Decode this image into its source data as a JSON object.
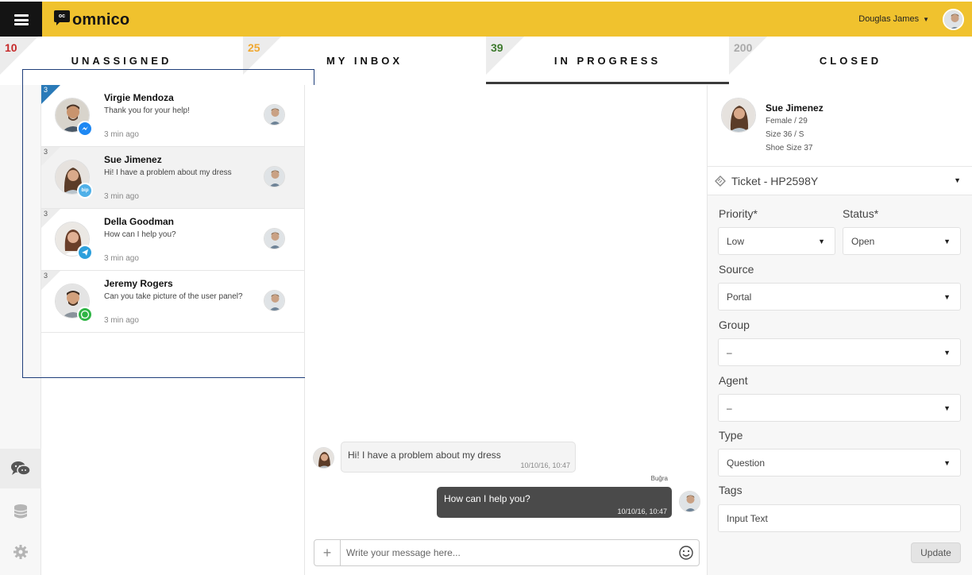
{
  "header": {
    "logo_mark": "oc",
    "logo_text": "omnico",
    "user_name": "Douglas James"
  },
  "tabs": [
    {
      "count": "10",
      "count_color": "#c62828",
      "label": "UNASSIGNED",
      "active": false
    },
    {
      "count": "25",
      "count_color": "#f0a830",
      "label": "MY INBOX",
      "active": false
    },
    {
      "count": "39",
      "count_color": "#3e7a2e",
      "label": "IN PROGRESS",
      "active": true
    },
    {
      "count": "200",
      "count_color": "#aaaaaa",
      "label": "CLOSED",
      "active": false
    }
  ],
  "rail": [
    "chat-icon",
    "database-icon",
    "settings-icon"
  ],
  "conversations": [
    {
      "badge": "3",
      "name": "Virgie Mendoza",
      "message": "Thank you for your help!",
      "time": "3 min ago",
      "channel": "messenger-icon",
      "channel_color": "#1e88f3"
    },
    {
      "badge": "3",
      "name": "Sue Jimenez",
      "message": "Hi! I have a problem about my dress",
      "time": "3 min ago",
      "channel": "bip-icon",
      "channel_color": "#4fb0e8",
      "channel_text": "bip"
    },
    {
      "badge": "3",
      "name": "Della Goodman",
      "message": "How can I help you?",
      "time": "3 min ago",
      "channel": "telegram-icon",
      "channel_color": "#2ea0dc"
    },
    {
      "badge": "3",
      "name": "Jeremy Rogers",
      "message": "Can you take picture of the user panel?",
      "time": "3 min ago",
      "channel": "whatsapp-icon",
      "channel_color": "#2fb545"
    }
  ],
  "chat": {
    "incoming": {
      "text": "Hi! I have a problem about my dress",
      "time": "10/10/16, 10:47"
    },
    "outgoing_sender": "Buğra",
    "outgoing": {
      "text": "How can I help you?",
      "time": "10/10/16, 10:47"
    },
    "composer_placeholder": "Write your message here..."
  },
  "profile": {
    "name": "Sue Jimenez",
    "gender_age": "Female / 29",
    "size": "Size 36 / S",
    "shoe_size": "Shoe Size 37"
  },
  "ticket": {
    "label": "Ticket - HP2598Y",
    "priority_label": "Priority*",
    "priority_value": "Low",
    "status_label": "Status*",
    "status_value": "Open",
    "source_label": "Source",
    "source_value": "Portal",
    "group_label": "Group",
    "group_value": "–",
    "agent_label": "Agent",
    "agent_value": "–",
    "type_label": "Type",
    "type_value": "Question",
    "tags_label": "Tags",
    "tags_placeholder": "Input Text",
    "update_label": "Update"
  },
  "colors": {
    "header_bg": "#f0c22e",
    "menu_bg": "#141414",
    "outgoing_bubble": "#4a4a4a",
    "highlight_border": "#1f3e7a"
  }
}
